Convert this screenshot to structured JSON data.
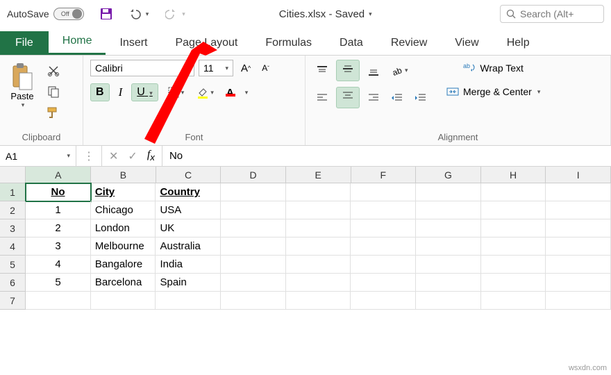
{
  "titlebar": {
    "autosave_label": "AutoSave",
    "autosave_state": "Off",
    "filename": "Cities.xlsx - Saved",
    "search_placeholder": "Search (Alt+"
  },
  "tabs": {
    "file": "File",
    "home": "Home",
    "insert": "Insert",
    "page_layout": "Page Layout",
    "formulas": "Formulas",
    "data": "Data",
    "review": "Review",
    "view": "View",
    "help": "Help"
  },
  "ribbon": {
    "clipboard": {
      "label": "Clipboard",
      "paste": "Paste"
    },
    "font": {
      "label": "Font",
      "family": "Calibri",
      "size": "11",
      "bold": "B",
      "italic": "I",
      "underline": "U"
    },
    "alignment": {
      "label": "Alignment",
      "wrap": "Wrap Text",
      "merge": "Merge & Center"
    }
  },
  "formula_bar": {
    "namebox": "A1",
    "content": "No"
  },
  "grid": {
    "columns": [
      "A",
      "B",
      "C",
      "D",
      "E",
      "F",
      "G",
      "H",
      "I"
    ],
    "rows": [
      {
        "n": "1",
        "cells": [
          "No",
          "City",
          "Country",
          "",
          "",
          "",
          "",
          "",
          ""
        ],
        "header": true
      },
      {
        "n": "2",
        "cells": [
          "1",
          "Chicago",
          "USA",
          "",
          "",
          "",
          "",
          "",
          ""
        ]
      },
      {
        "n": "3",
        "cells": [
          "2",
          "London",
          "UK",
          "",
          "",
          "",
          "",
          "",
          ""
        ]
      },
      {
        "n": "4",
        "cells": [
          "3",
          "Melbourne",
          "Australia",
          "",
          "",
          "",
          "",
          "",
          ""
        ]
      },
      {
        "n": "5",
        "cells": [
          "4",
          "Bangalore",
          "India",
          "",
          "",
          "",
          "",
          "",
          ""
        ]
      },
      {
        "n": "6",
        "cells": [
          "5",
          "Barcelona",
          "Spain",
          "",
          "",
          "",
          "",
          "",
          ""
        ]
      },
      {
        "n": "7",
        "cells": [
          "",
          "",
          "",
          "",
          "",
          "",
          "",
          "",
          ""
        ]
      }
    ]
  },
  "colors": {
    "accent": "#217346",
    "arrow": "#ff0000"
  },
  "watermark": "wsxdn.com"
}
